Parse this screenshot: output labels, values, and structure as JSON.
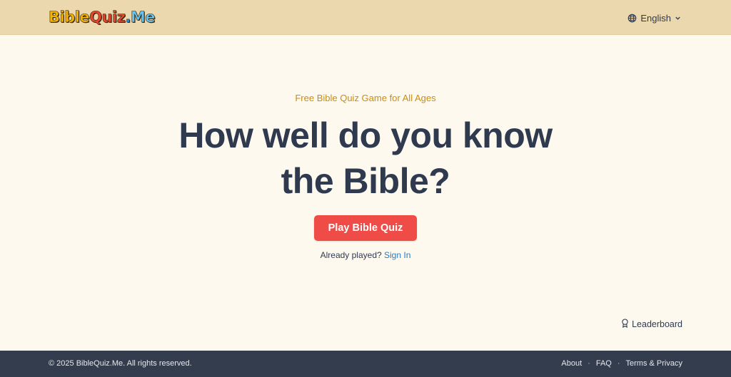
{
  "header": {
    "logo_parts": [
      "Bible",
      "Quiz",
      ".",
      "Me"
    ],
    "language": "English",
    "language_icon": "globe-icon",
    "dropdown_icon": "chevron-down-icon"
  },
  "hero": {
    "eyebrow": "Free Bible Quiz Game for All Ages",
    "headline_line1": "How well do you know",
    "headline_line2": "the Bible?",
    "play_button": "Play Bible Quiz",
    "already_played": "Already played?",
    "sign_in": "Sign In"
  },
  "leaderboard": {
    "label": "Leaderboard",
    "icon": "award-icon"
  },
  "footer": {
    "copyright": "© 2025 BibleQuiz.Me. All rights reserved.",
    "links": [
      "About",
      "FAQ",
      "Terms & Privacy"
    ],
    "separator": "·"
  },
  "colors": {
    "header_bg": "#ecd8ae",
    "page_bg": "#fdf9ee",
    "eyebrow": "#c98d14",
    "headline": "#2f3a4f",
    "play_button_bg": "#ef4c47",
    "link": "#2a7ac0",
    "footer_bg": "#343d4e"
  }
}
